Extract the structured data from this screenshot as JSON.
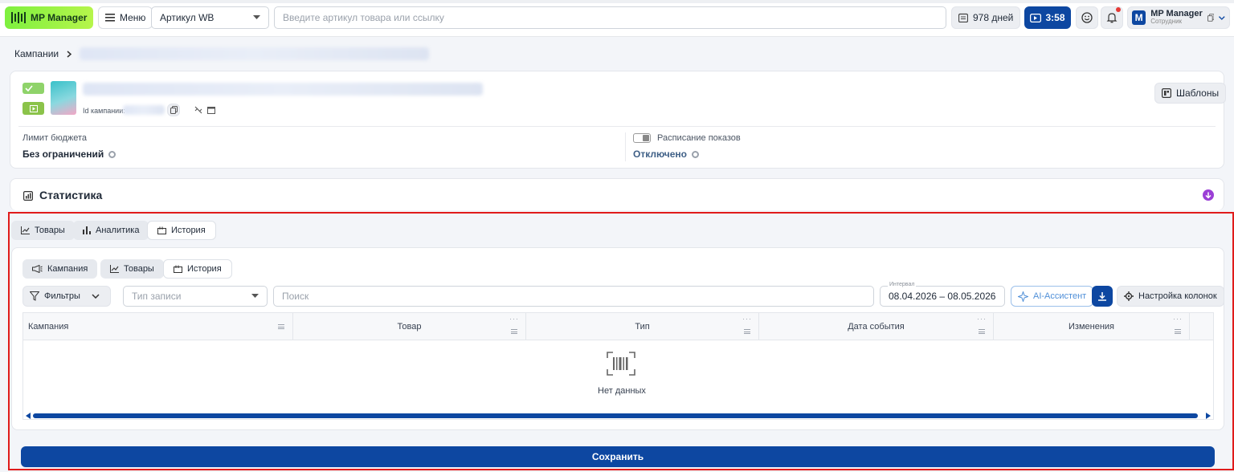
{
  "topbar": {
    "logo_text": "MP Manager",
    "menu_label": "Меню",
    "article_type": "Артикул WB",
    "search_placeholder": "Введите артикул товара или ссылку",
    "days_label": "978 дней",
    "timer_label": "3:58",
    "account_name": "MP Manager",
    "account_role": "Сотрудник",
    "avatar_letter": "M"
  },
  "breadcrumb": {
    "root": "Кампании"
  },
  "campaign": {
    "id_label": "Id кампании:",
    "templates_label": "Шаблоны",
    "budget_label": "Лимит бюджета",
    "budget_value": "Без ограничений",
    "schedule_label": "Расписание показов",
    "schedule_value": "Отключено"
  },
  "statistics": {
    "title": "Статистика"
  },
  "outer_tabs": [
    {
      "label": "Товары"
    },
    {
      "label": "Аналитика"
    },
    {
      "label": "История"
    }
  ],
  "inner_tabs": [
    {
      "label": "Кампания"
    },
    {
      "label": "Товары"
    },
    {
      "label": "История"
    }
  ],
  "filters": {
    "filters_label": "Фильтры",
    "record_type_placeholder": "Тип записи",
    "search_placeholder": "Поиск",
    "interval_label": "Интервал",
    "interval_value": "08.04.2026 – 08.05.2026",
    "ai_label": "AI-Ассистент",
    "columns_label": "Настройка колонок"
  },
  "table": {
    "columns": [
      "Кампания",
      "Товар",
      "Тип",
      "Дата события",
      "Изменения"
    ],
    "empty_text": "Нет данных"
  },
  "save_label": "Сохранить",
  "colors": {
    "primary": "#0d47a1",
    "logo_green": "#7ef03f",
    "highlight_red": "#e01b1b",
    "ai_accent": "#4f8fd8",
    "stat_purple": "#9b3fd6"
  }
}
